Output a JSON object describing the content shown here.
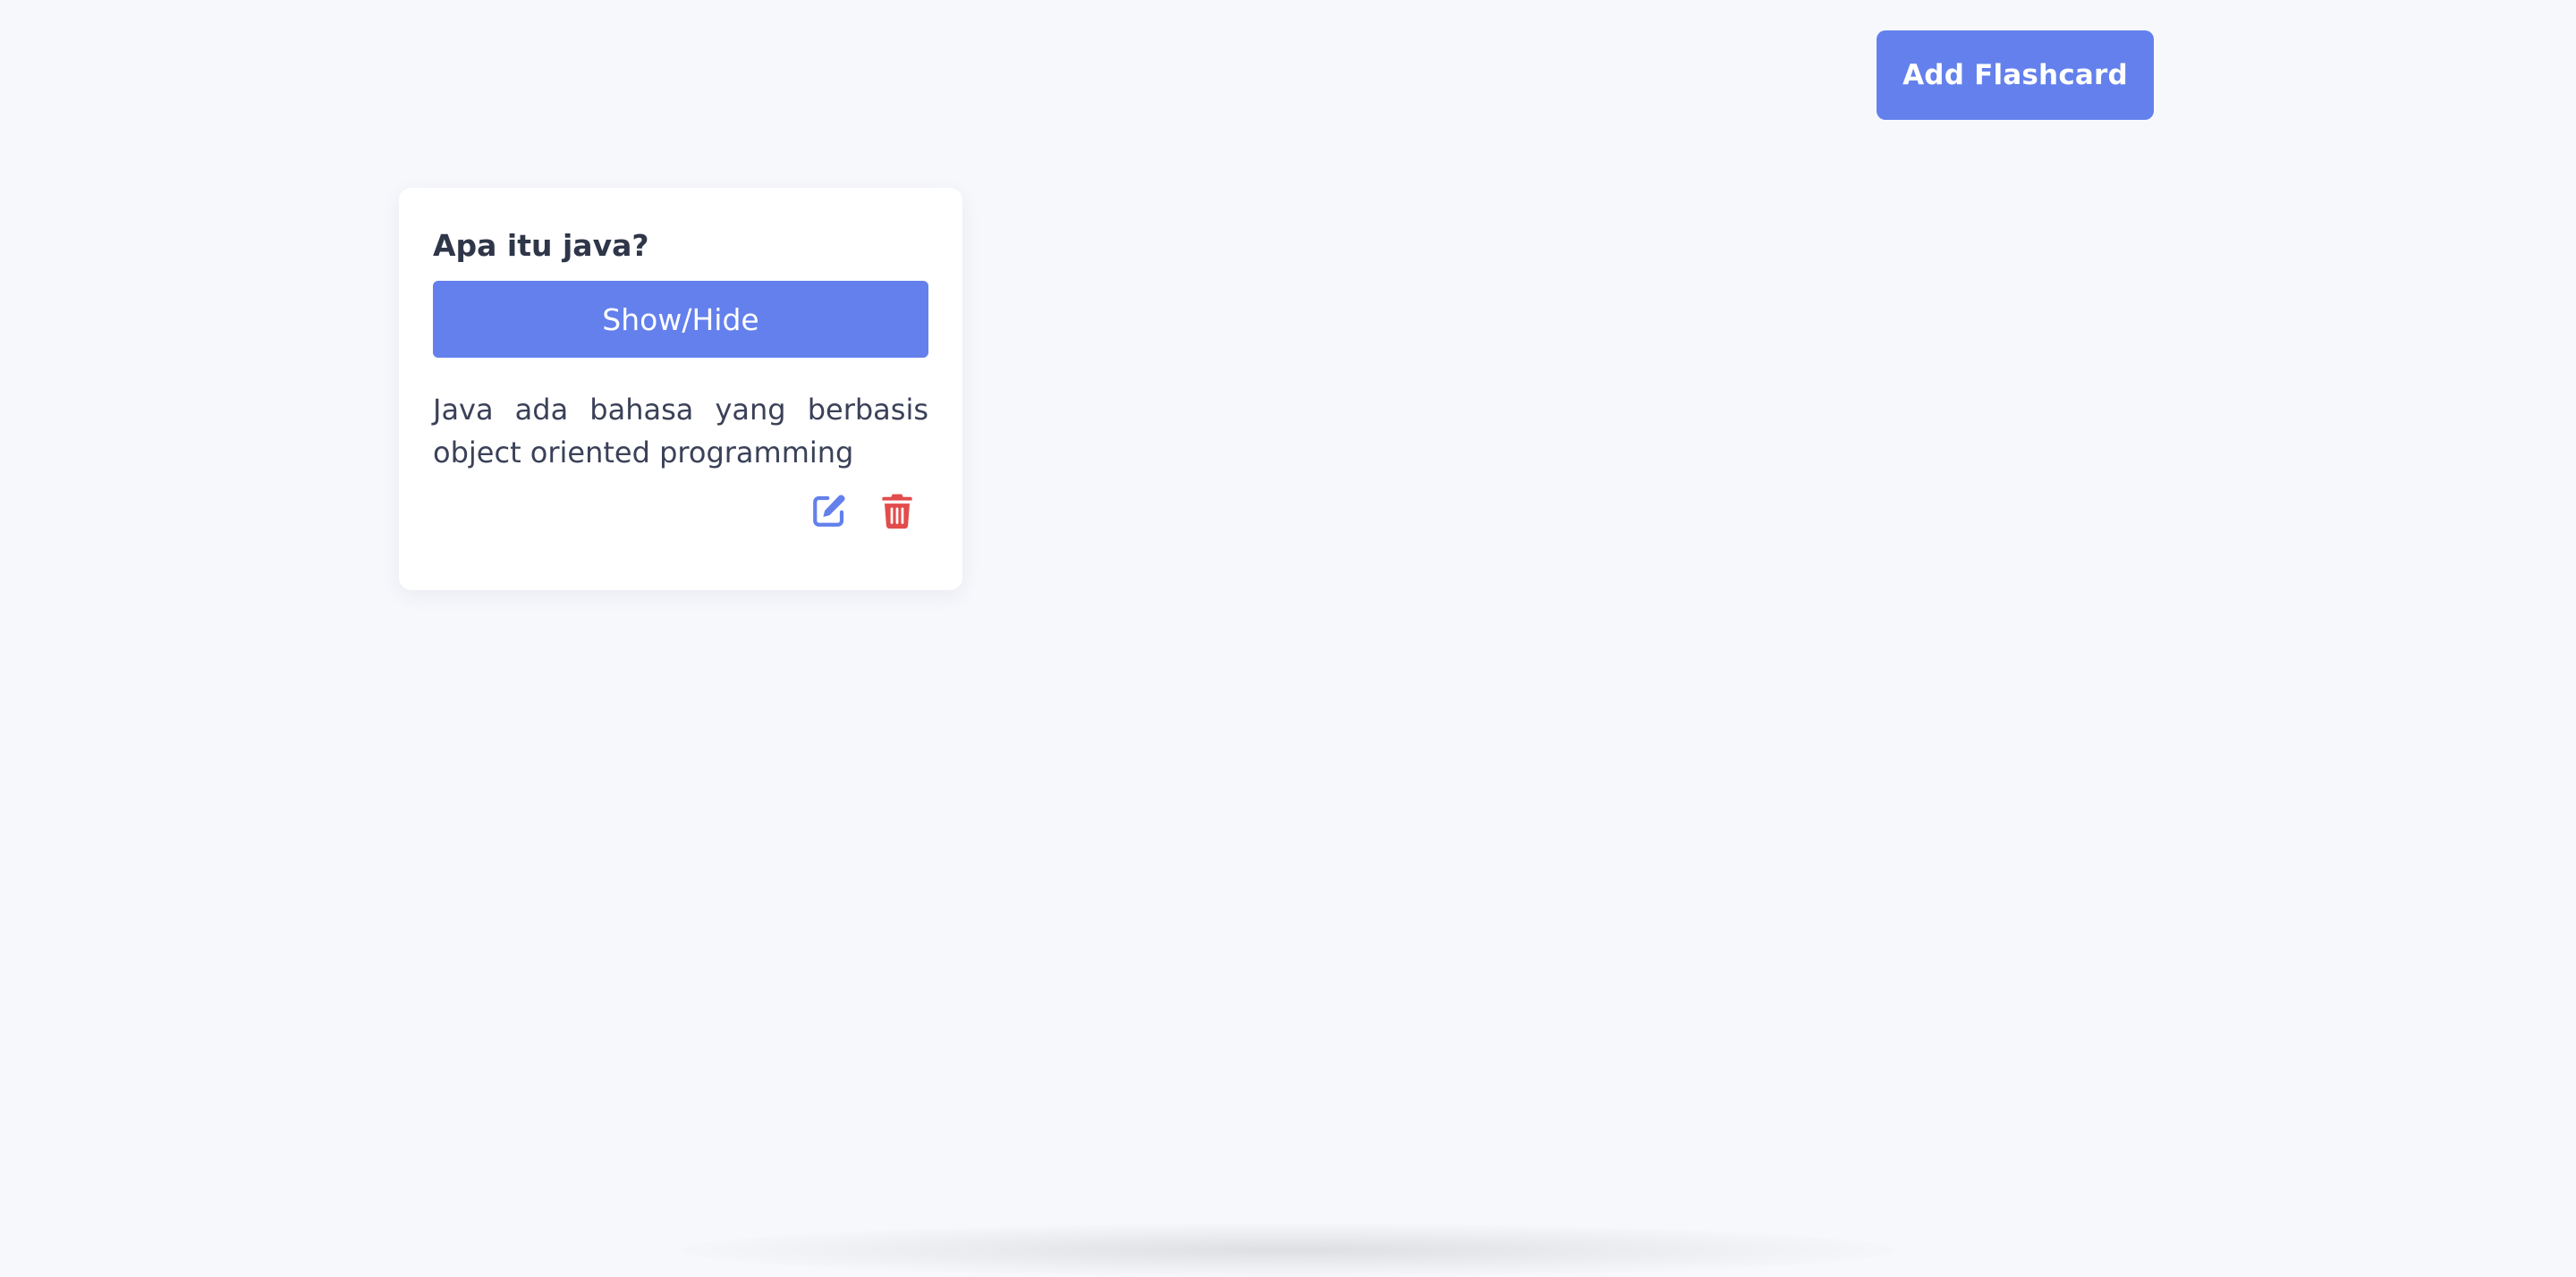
{
  "header": {
    "add_button_label": "Add Flashcard"
  },
  "flashcards": [
    {
      "question": "Apa itu java?",
      "toggle_label": "Show/Hide",
      "answer": "Java ada bahasa yang berbasis object oriented programming",
      "edit_icon": "edit-icon",
      "delete_icon": "trash-icon"
    }
  ],
  "colors": {
    "background": "#f7f8fc",
    "accent": "#6380ec",
    "danger": "#e24c4b",
    "text": "#2f3649"
  }
}
